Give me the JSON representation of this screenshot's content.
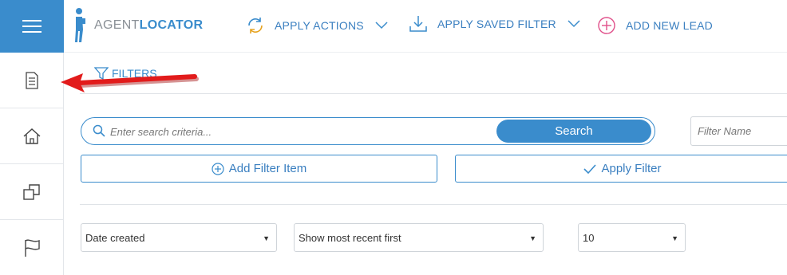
{
  "app": {
    "logo_word_light": "AGENT",
    "logo_word_bold": "LOCATOR"
  },
  "sidebar": {
    "items": [
      {
        "name": "document-icon"
      },
      {
        "name": "home-icon"
      },
      {
        "name": "copy-icon"
      },
      {
        "name": "flag-icon"
      }
    ]
  },
  "toolbar": {
    "apply_actions": "APPLY ACTIONS",
    "apply_saved_filter": "APPLY SAVED FILTER",
    "add_new_lead": "ADD NEW LEAD"
  },
  "filters": {
    "tab_label": "FILTERS",
    "search_placeholder": "Enter search criteria...",
    "search_button": "Search",
    "filter_name_placeholder": "Filter Name",
    "add_filter_item": "Add Filter Item",
    "apply_filter": "Apply Filter"
  },
  "sorting": {
    "sort_field": "Date created",
    "sort_order": "Show most recent first",
    "page_size": "10"
  },
  "colors": {
    "accent": "#3a8ccc",
    "annotation_arrow": "#e21b1b",
    "add_lead_icon": "#e0508a"
  }
}
